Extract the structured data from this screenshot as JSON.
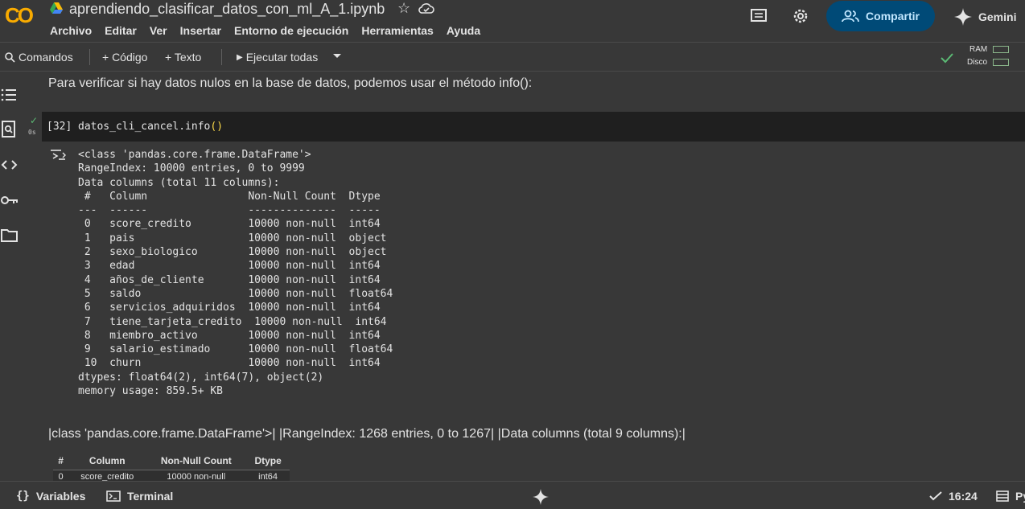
{
  "header": {
    "logo_text": "CO",
    "notebook_title": "aprendiendo_clasificar_datos_con_ml_A_1.ipynb",
    "menu": [
      "Archivo",
      "Editar",
      "Ver",
      "Insertar",
      "Entorno de ejecución",
      "Herramientas",
      "Ayuda"
    ],
    "share_label": "Compartir",
    "gemini_label": "Gemini",
    "icons": [
      "drive-icon",
      "star-icon",
      "cloud-icon",
      "comment-icon",
      "settings-icon",
      "people-icon",
      "gemini-icon"
    ]
  },
  "toolbar": {
    "commands_label": "Comandos",
    "add_code_label": "+ Código",
    "add_text_label": "+ Texto",
    "run_all_label": "Ejecutar todas",
    "ram_label": "RAM",
    "disk_label": "Disco"
  },
  "sidebar": {
    "icons": [
      "toc-icon",
      "find-icon",
      "code-snippets-icon",
      "secrets-key-icon",
      "files-folder-icon"
    ]
  },
  "cells": {
    "text_cell": "Para verificar si hay datos nulos en la base de datos, podemos usar el método info():",
    "code_cell": {
      "exec_count": "[32]",
      "code_prefix": "datos_cli_cancel.info",
      "code_parens": "()",
      "run_status": "✓",
      "run_time": "0s"
    },
    "output_lines": [
      "<class 'pandas.core.frame.DataFrame'>",
      "RangeIndex: 10000 entries, 0 to 9999",
      "Data columns (total 11 columns):",
      " #   Column                Non-Null Count  Dtype  ",
      "---  ------                --------------  -----  ",
      " 0   score_credito         10000 non-null  int64  ",
      " 1   pais                  10000 non-null  object ",
      " 2   sexo_biologico        10000 non-null  object ",
      " 3   edad                  10000 non-null  int64  ",
      " 4   años_de_cliente       10000 non-null  int64  ",
      " 5   saldo                 10000 non-null  float64",
      " 6   servicios_adquiridos  10000 non-null  int64  ",
      " 7   tiene_tarjeta_credito  10000 non-null  int64  ",
      " 8   miembro_activo        10000 non-null  int64  ",
      " 9   salario_estimado      10000 non-null  float64",
      " 10  churn                 10000 non-null  int64  ",
      "dtypes: float64(2), int64(7), object(2)",
      "memory usage: 859.5+ KB"
    ],
    "markdown_text": "|class 'pandas.core.frame.DataFrame'>| |RangeIndex: 1268 entries, 0 to 1267| |Data columns (total 9 columns):|",
    "markdown_table": {
      "headers": [
        "#",
        "Column",
        "Non-Null Count",
        "Dtype"
      ],
      "rows": [
        [
          "0",
          "score_credito",
          "10000 non-null",
          "int64"
        ]
      ]
    }
  },
  "statusbar": {
    "variables_label": "Variables",
    "terminal_label": "Terminal",
    "time": "16:24",
    "right_label": "Py"
  }
}
